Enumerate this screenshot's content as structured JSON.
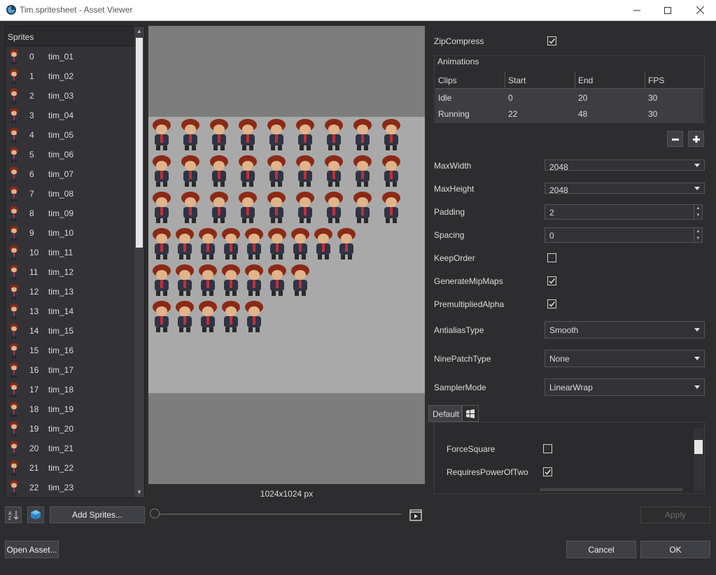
{
  "window": {
    "title": "Tim.spritesheet - Asset Viewer",
    "icons": [
      "app-logo-icon",
      "minimize-icon",
      "maximize-icon",
      "close-icon"
    ]
  },
  "sprites": {
    "header": "Sprites",
    "items": [
      {
        "index": "0",
        "name": "tim_01"
      },
      {
        "index": "1",
        "name": "tim_02"
      },
      {
        "index": "2",
        "name": "tim_03"
      },
      {
        "index": "3",
        "name": "tim_04"
      },
      {
        "index": "4",
        "name": "tim_05"
      },
      {
        "index": "5",
        "name": "tim_06"
      },
      {
        "index": "6",
        "name": "tim_07"
      },
      {
        "index": "7",
        "name": "tim_08"
      },
      {
        "index": "8",
        "name": "tim_09"
      },
      {
        "index": "9",
        "name": "tim_10"
      },
      {
        "index": "10",
        "name": "tim_11"
      },
      {
        "index": "11",
        "name": "tim_12"
      },
      {
        "index": "12",
        "name": "tim_13"
      },
      {
        "index": "13",
        "name": "tim_14"
      },
      {
        "index": "14",
        "name": "tim_15"
      },
      {
        "index": "15",
        "name": "tim_16"
      },
      {
        "index": "16",
        "name": "tim_17"
      },
      {
        "index": "17",
        "name": "tim_18"
      },
      {
        "index": "18",
        "name": "tim_19"
      },
      {
        "index": "19",
        "name": "tim_20"
      },
      {
        "index": "20",
        "name": "tim_21"
      },
      {
        "index": "21",
        "name": "tim_22"
      },
      {
        "index": "22",
        "name": "tim_23"
      }
    ]
  },
  "preview": {
    "dimensions": "1024x1024 px"
  },
  "toolbar": {
    "add_sprites": "Add Sprites...",
    "open_asset": "Open Asset...",
    "apply": "Apply",
    "cancel": "Cancel",
    "ok": "OK"
  },
  "properties": {
    "zip_compress": {
      "label": "ZipCompress",
      "checked": true
    },
    "animations": {
      "label": "Animations",
      "columns": [
        "Clips",
        "Start",
        "End",
        "FPS"
      ],
      "rows": [
        [
          "Idle",
          "0",
          "20",
          "30"
        ],
        [
          "Running",
          "22",
          "48",
          "30"
        ]
      ]
    },
    "max_width": {
      "label": "MaxWidth",
      "value": "2048"
    },
    "max_height": {
      "label": "MaxHeight",
      "value": "2048"
    },
    "padding": {
      "label": "Padding",
      "value": "2"
    },
    "spacing": {
      "label": "Spacing",
      "value": "0"
    },
    "keep_order": {
      "label": "KeepOrder",
      "checked": false
    },
    "generate_mipmaps": {
      "label": "GenerateMipMaps",
      "checked": true
    },
    "premultiplied_alpha": {
      "label": "PremultipliedAlpha",
      "checked": true
    },
    "antialias_type": {
      "label": "AntialiasType",
      "value": "Smooth"
    },
    "nine_patch_type": {
      "label": "NinePatchType",
      "value": "None"
    },
    "sampler_mode": {
      "label": "SamplerMode",
      "value": "LinearWrap"
    }
  },
  "platform_tabs": {
    "default_label": "Default",
    "force_square": {
      "label": "ForceSquare",
      "checked": false
    },
    "requires_pow2": {
      "label": "RequiresPowerOfTwo",
      "checked": true
    }
  }
}
